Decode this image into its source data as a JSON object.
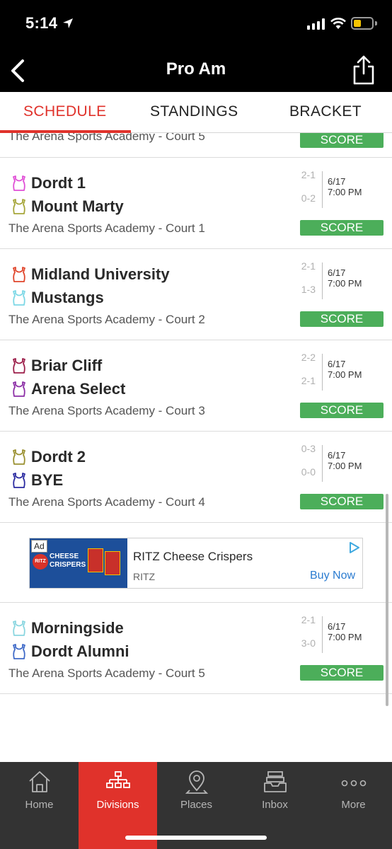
{
  "status_bar": {
    "time": "5:14"
  },
  "nav": {
    "title": "Pro Am"
  },
  "tabs": [
    {
      "label": "SCHEDULE",
      "active": true
    },
    {
      "label": "STANDINGS",
      "active": false
    },
    {
      "label": "BRACKET",
      "active": false
    }
  ],
  "games": [
    {
      "venue": "The Arena Sports Academy - Court 5",
      "score_label": "SCORE"
    },
    {
      "team1": {
        "name": "Dordt 1",
        "record": "2-1",
        "color": "#e04fd6"
      },
      "team2": {
        "name": "Mount Marty",
        "record": "0-2",
        "color": "#a6a63a"
      },
      "date": "6/17",
      "time": "7:00 PM",
      "venue": "The Arena Sports Academy - Court 1",
      "score_label": "SCORE"
    },
    {
      "team1": {
        "name": "Midland University",
        "record": "2-1",
        "color": "#e0452b"
      },
      "team2": {
        "name": "Mustangs",
        "record": "1-3",
        "color": "#7dd8e6"
      },
      "date": "6/17",
      "time": "7:00 PM",
      "venue": "The Arena Sports Academy - Court 2",
      "score_label": "SCORE"
    },
    {
      "team1": {
        "name": "Briar Cliff",
        "record": "2-2",
        "color": "#9c1f4a"
      },
      "team2": {
        "name": "Arena Select",
        "record": "2-1",
        "color": "#8c2fa6"
      },
      "date": "6/17",
      "time": "7:00 PM",
      "venue": "The Arena Sports Academy - Court 3",
      "score_label": "SCORE"
    },
    {
      "team1": {
        "name": "Dordt 2",
        "record": "0-3",
        "color": "#9a9030"
      },
      "team2": {
        "name": "BYE",
        "record": "0-0",
        "color": "#2a2aa0"
      },
      "date": "6/17",
      "time": "7:00 PM",
      "venue": "The Arena Sports Academy - Court 4",
      "score_label": "SCORE"
    },
    {
      "team1": {
        "name": "Morningside",
        "record": "2-1",
        "color": "#8ad6e0"
      },
      "team2": {
        "name": "Dordt Alumni",
        "record": "3-0",
        "color": "#3f6ac8"
      },
      "date": "6/17",
      "time": "7:00 PM",
      "venue": "The Arena Sports Academy - Court 5",
      "score_label": "SCORE"
    }
  ],
  "ad": {
    "badge": "Ad",
    "logo": "RITZ",
    "image_text": "CHEESE\nCRISPERS",
    "title": "RITZ Cheese Crispers",
    "brand": "RITZ",
    "cta": "Buy Now"
  },
  "tabbar": [
    {
      "label": "Home",
      "icon": "home-icon",
      "active": false
    },
    {
      "label": "Divisions",
      "icon": "bracket-icon",
      "active": true
    },
    {
      "label": "Places",
      "icon": "map-pin-icon",
      "active": false
    },
    {
      "label": "Inbox",
      "icon": "inbox-icon",
      "active": false
    },
    {
      "label": "More",
      "icon": "more-dots-icon",
      "active": false
    }
  ],
  "colors": {
    "accent": "#e0322b",
    "score_green": "#4cae5a",
    "bar_bg": "#000000",
    "tabbar_bg": "#333333"
  }
}
